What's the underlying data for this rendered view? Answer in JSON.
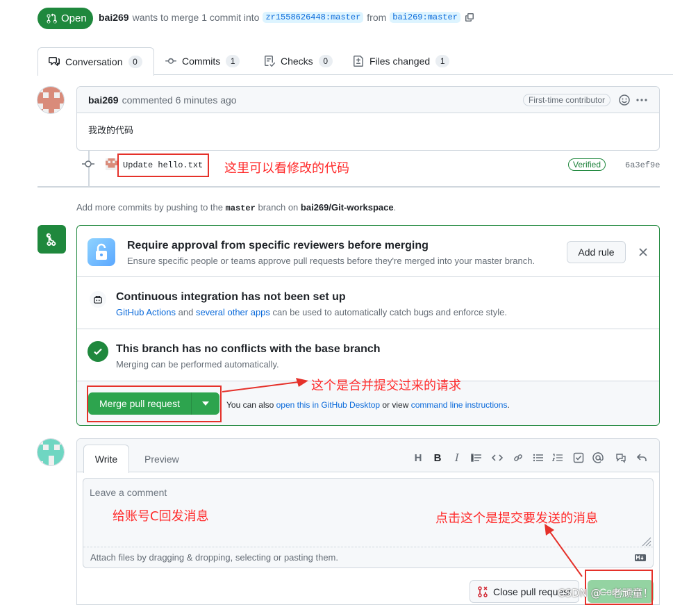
{
  "header": {
    "state": "Open",
    "author": "bai269",
    "action_text": "wants to merge 1 commit into",
    "base_branch": "zr1558626448:master",
    "from_text": "from",
    "head_branch": "bai269:master"
  },
  "tabs": [
    {
      "label": "Conversation",
      "count": "0"
    },
    {
      "label": "Commits",
      "count": "1"
    },
    {
      "label": "Checks",
      "count": "0"
    },
    {
      "label": "Files changed",
      "count": "1"
    }
  ],
  "comment": {
    "author": "bai269",
    "meta": "commented 6 minutes ago",
    "badge": "First-time contributor",
    "body": "我改的代码"
  },
  "commit": {
    "message": "Update hello.txt",
    "verified": "Verified",
    "sha": "6a3ef9e"
  },
  "add_commits": {
    "prefix": "Add more commits by pushing to the",
    "branch": "master",
    "middle": "branch on",
    "repo": "bai269/Git-workspace",
    "suffix": "."
  },
  "mergebox": {
    "review": {
      "title": "Require approval from specific reviewers before merging",
      "subtitle": "Ensure specific people or teams approve pull requests before they're merged into your master branch.",
      "add_rule": "Add rule"
    },
    "ci": {
      "title": "Continuous integration has not been set up",
      "link1": "GitHub Actions",
      "and": "and",
      "link2": "several other apps",
      "rest": "can be used to automatically catch bugs and enforce style."
    },
    "conflicts": {
      "title": "This branch has no conflicts with the base branch",
      "subtitle": "Merging can be performed automatically."
    },
    "merge_button": "Merge pull request",
    "also_prefix": "You can also",
    "desktop_link": "open this in GitHub Desktop",
    "or_view": "or view",
    "cli_link": "command line instructions",
    "suffix": "."
  },
  "composer": {
    "tab_write": "Write",
    "tab_preview": "Preview",
    "placeholder": "Leave a comment",
    "attach_text": "Attach files by dragging & dropping, selecting or pasting them.",
    "close_button": "Close pull request",
    "comment_button": "Comment"
  },
  "annotations": {
    "note_commit": "这里可以看修改的代码",
    "note_merge": "这个是合并提交过来的请求",
    "note_reply": "给账号C回发消息",
    "note_submit": "点击这个是提交要发送的消息",
    "watermark": "CSDN @一老顽童！"
  },
  "colors": {
    "green": "#1f883d",
    "link": "#0969da",
    "annotation_red": "#e5312a"
  }
}
